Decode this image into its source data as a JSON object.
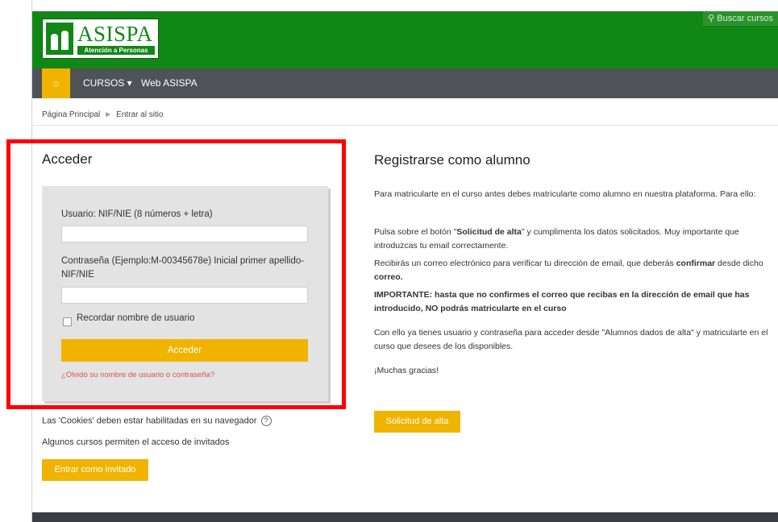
{
  "header": {
    "logo_text": "ASISPA",
    "logo_subtitle": "Atención a Personas",
    "search_label": "Buscar cursos"
  },
  "nav": {
    "home_icon": "⌂",
    "items": [
      "CURSOS ▾",
      "Web ASISPA"
    ]
  },
  "breadcrumb": {
    "items": [
      "Página Principal",
      "Entrar al sitio"
    ],
    "separator": "►"
  },
  "login": {
    "title": "Acceder",
    "username_label": "Usuario: NIF/NIE (8 números + letra)",
    "username_value": "",
    "password_label_line1": "Contraseña (Ejemplo:M-00345678e) Inicial primer apellido-",
    "password_label_line2": "NIF/NIE",
    "password_value": "",
    "remember_label": "Recordar nombre de usuario",
    "submit_label": "Acceder",
    "forgot_label": "¿Olvidó su nombre de usuario o contraseña?",
    "cookies_text": "Las 'Cookies' deben estar habilitadas en su navegador",
    "help_icon": "?",
    "guests_text": "Algunos cursos permiten el acceso de invitados",
    "guest_button": "Entrar como invitado"
  },
  "register": {
    "title": "Registrarse como alumno",
    "p1": "Para matricularte en el curso antes debes matricularte como alumno en nuestra plataforma. Para ello:",
    "p2_a": "Pulsa sobre el botón \"",
    "p2_b": "Solicitud de alta",
    "p2_c": "\" y cumplimenta los datos solicitados. Muy importante que introduzcas tu email correctamente.",
    "p3_a": "Recibirás un correo electrónico para verificar tu dirección de email, que deberás ",
    "p3_b": "confirmar",
    "p3_c": " desde dicho ",
    "p3_d": "correo.",
    "p4": "IMPORTANTE: hasta que no confirmes el correo que recibas en la dirección de email que has introducido, NO podrás matricularte en el curso",
    "p5": "Con ello ya tienes usuario y contraseña para acceder desde \"Alumnos dados de alta\" y matricularte en el curso que desees de los disponibles.",
    "p6": "¡Muchas gracias!",
    "button": "Solicitud de alta"
  },
  "colors": {
    "header_green": "#118715",
    "navbar_gray": "#4f5358",
    "accent_yellow": "#f0b400",
    "highlight_red": "#ff0000"
  }
}
